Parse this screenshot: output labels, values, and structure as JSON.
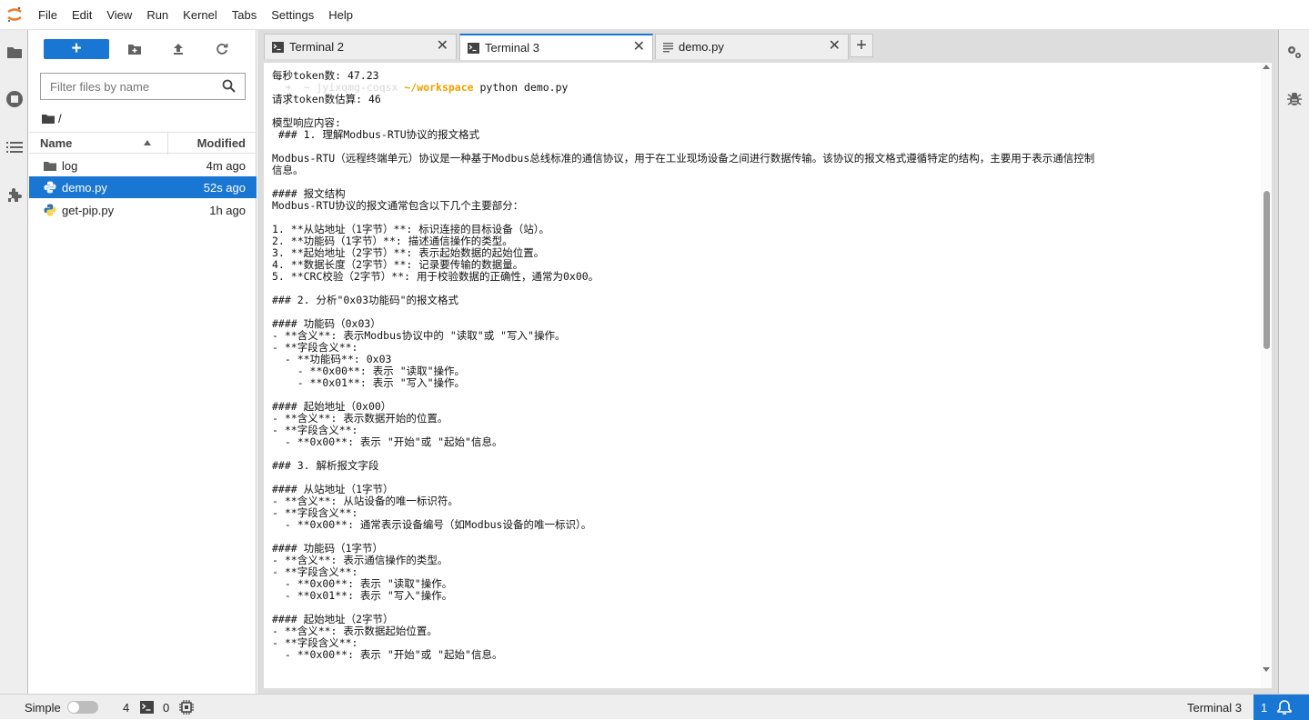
{
  "menu": [
    "File",
    "Edit",
    "View",
    "Run",
    "Kernel",
    "Tabs",
    "Settings",
    "Help"
  ],
  "filebrowser": {
    "new_label": "+",
    "filter_placeholder": "Filter files by name",
    "breadcrumb": "/",
    "columns": {
      "name": "Name",
      "modified": "Modified"
    },
    "files": [
      {
        "name": "log",
        "modified": "4m ago",
        "type": "folder"
      },
      {
        "name": "demo.py",
        "modified": "52s ago",
        "type": "python"
      },
      {
        "name": "get-pip.py",
        "modified": "1h ago",
        "type": "python"
      }
    ]
  },
  "tabs": [
    {
      "label": "Terminal 2",
      "type": "terminal",
      "active": false
    },
    {
      "label": "Terminal 3",
      "type": "terminal",
      "active": true
    },
    {
      "label": "demo.py",
      "type": "file",
      "active": false
    }
  ],
  "terminal": {
    "prompt_faint": "  ➜  ~ jyixqmg-coqsx",
    "prompt_dir": " ~/workspace",
    "prompt_cmd": " python demo.py",
    "lines": [
      "每秒token数: 47.23",
      "",
      "请求token数估算: 46",
      "",
      "模型响应内容:",
      " ### 1. 理解Modbus-RTU协议的报文格式",
      "",
      "Modbus-RTU（远程终端单元）协议是一种基于Modbus总线标准的通信协议，用于在工业现场设备之间进行数据传输。该协议的报文格式遵循特定的结构，主要用于表示通信控制",
      "信息。",
      "",
      "#### 报文结构",
      "Modbus-RTU协议的报文通常包含以下几个主要部分：",
      "",
      "1. **从站地址（1字节）**: 标识连接的目标设备（站）。",
      "2. **功能码（1字节）**: 描述通信操作的类型。",
      "3. **起始地址（2字节）**: 表示起始数据的起始位置。",
      "4. **数据长度（2字节）**: 记录要传输的数据量。",
      "5. **CRC校验（2字节）**: 用于校验数据的正确性，通常为0x00。",
      "",
      "### 2. 分析\"0x03功能码\"的报文格式",
      "",
      "#### 功能码（0x03）",
      "- **含义**: 表示Modbus协议中的 \"读取\"或 \"写入\"操作。",
      "- **字段含义**:",
      "  - **功能码**: 0x03",
      "    - **0x00**: 表示 \"读取\"操作。",
      "    - **0x01**: 表示 \"写入\"操作。",
      "",
      "#### 起始地址（0x00）",
      "- **含义**: 表示数据开始的位置。",
      "- **字段含义**:",
      "  - **0x00**: 表示 \"开始\"或 \"起始\"信息。",
      "",
      "### 3. 解析报文字段",
      "",
      "#### 从站地址（1字节）",
      "- **含义**: 从站设备的唯一标识符。",
      "- **字段含义**:",
      "  - **0x00**: 通常表示设备编号（如Modbus设备的唯一标识）。",
      "",
      "#### 功能码（1字节）",
      "- **含义**: 表示通信操作的类型。",
      "- **字段含义**:",
      "  - **0x00**: 表示 \"读取\"操作。",
      "  - **0x01**: 表示 \"写入\"操作。",
      "",
      "#### 起始地址（2字节）",
      "- **含义**: 表示数据起始位置。",
      "- **字段含义**:",
      "  - **0x00**: 表示 \"开始\"或 \"起始\"信息。"
    ]
  },
  "statusbar": {
    "mode": "Simple",
    "terminals_count": "4",
    "kernels_count": "0",
    "active_label": "Terminal 3",
    "notifications": "1"
  },
  "colors": {
    "accent": "#1976d2",
    "prompt_dir": "#f0a000"
  }
}
